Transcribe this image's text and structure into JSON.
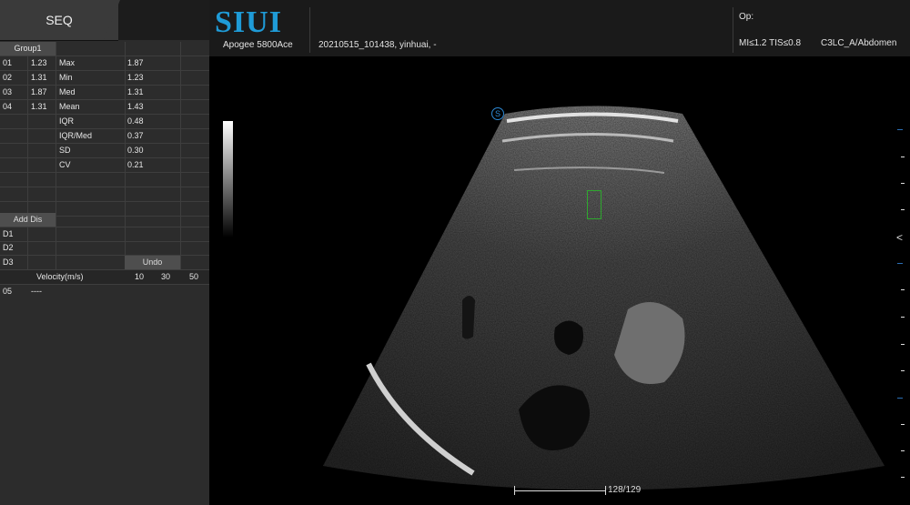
{
  "left_panel": {
    "seq_tab": "SEQ",
    "group_label": "Group1",
    "rows": [
      {
        "idx": "01",
        "val": "1.23",
        "stat": "Max",
        "stat_val": "1.87"
      },
      {
        "idx": "02",
        "val": "1.31",
        "stat": "Min",
        "stat_val": "1.23"
      },
      {
        "idx": "03",
        "val": "1.87",
        "stat": "Med",
        "stat_val": "1.31"
      },
      {
        "idx": "04",
        "val": "1.31",
        "stat": "Mean",
        "stat_val": "1.43"
      },
      {
        "idx": "",
        "val": "",
        "stat": "IQR",
        "stat_val": "0.48"
      },
      {
        "idx": "",
        "val": "",
        "stat": "IQR/Med",
        "stat_val": "0.37"
      },
      {
        "idx": "",
        "val": "",
        "stat": "SD",
        "stat_val": "0.30"
      },
      {
        "idx": "",
        "val": "",
        "stat": "CV",
        "stat_val": "0.21"
      }
    ],
    "add_dis": "Add Dis",
    "d_rows": [
      "D1",
      "D2",
      "D3"
    ],
    "undo": "Undo",
    "velocity_label": "Velocity(m/s)",
    "velocity_scale": [
      "10",
      "30",
      "50"
    ],
    "row05": {
      "idx": "05",
      "val": "----"
    }
  },
  "header": {
    "brand": "SIUI",
    "model": "Apogee 5800Ace",
    "patient": "20210515_101438, yinhuai, -",
    "op_label": "Op:",
    "indices": "MI≤1.2 TIS≤0.8",
    "probe": "C3LC_A/Abdomen"
  },
  "image": {
    "frame_counter": "128/129",
    "s_marker": "S"
  },
  "colors": {
    "panel_bg": "#2c2c2c",
    "brand_blue": "#1f9bd7",
    "roi_green": "#2ea82e"
  }
}
